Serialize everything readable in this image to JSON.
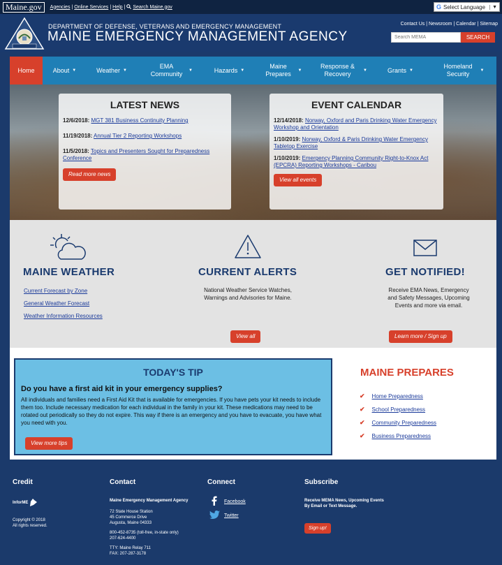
{
  "topbar": {
    "logo": "Maine.gov",
    "links": [
      "Agencies",
      "Online Services",
      "Help"
    ],
    "search_link": "Search Maine.gov",
    "language": "Select Language",
    "language_arrow": "▼"
  },
  "header": {
    "seal_top": "AGENCY",
    "seal_bottom": "STATE OF MAINE",
    "department": "DEPARTMENT OF DEFENSE, VETERANS AND EMERGENCY MANAGEMENT",
    "agency": "MAINE EMERGENCY MANAGEMENT AGENCY",
    "utility_links": [
      "Contact Us",
      "Newsroom",
      "Calendar",
      "Sitemap"
    ],
    "search_placeholder": "Search MEMA",
    "search_button": "SEARCH"
  },
  "nav": {
    "items": [
      {
        "label": "Home"
      },
      {
        "label": "About"
      },
      {
        "label": "Weather"
      },
      {
        "label": "EMA Community"
      },
      {
        "label": "Hazards"
      },
      {
        "label": "Maine Prepares"
      },
      {
        "label": "Response & Recovery"
      },
      {
        "label": "Grants"
      },
      {
        "label": "Homeland Security"
      }
    ]
  },
  "news": {
    "title": "LATEST NEWS",
    "items": [
      {
        "date": "12/6/2018:",
        "text": "MGT 381 Business Continuity Planning"
      },
      {
        "date": "11/19/2018:",
        "text": "Annual Tier 2 Reporting Workshops"
      },
      {
        "date": "11/5/2018:",
        "text": "Topics and Presenters Sought for Preparedness Conference"
      }
    ],
    "button": "Read more news"
  },
  "events": {
    "title": "EVENT CALENDAR",
    "items": [
      {
        "date": "12/14/2018:",
        "text": "Norway, Oxford and Paris Drinking Water Emergency Workshop and Orientation"
      },
      {
        "date": "1/10/2019:",
        "text": "Norway, Oxford & Paris Drinking Water Emergency Tabletop Exercise"
      },
      {
        "date": "1/10/2019:",
        "text": "Emergency Planning Community Right-to-Knox Act (EPCRA) Reporting Workshops - Caribou"
      }
    ],
    "button": "View all events"
  },
  "weather": {
    "title": "MAINE WEATHER",
    "links": [
      "Current Forecast by Zone",
      "General Weather Forecast",
      "Weather Information Resources"
    ]
  },
  "alerts": {
    "title": "CURRENT ALERTS",
    "text": "National Weather Service Watches, Warnings and Advisories for Maine.",
    "button": "View all"
  },
  "notified": {
    "title": "GET NOTIFIED!",
    "text": "Receive EMA News, Emergency and Safety Messages, Upcoming Events and more via email.",
    "button": "Learn more / Sign up"
  },
  "tip": {
    "title": "TODAY'S TIP",
    "question": "Do you have a first aid kit in your emergency supplies?",
    "body": "All individuals and families need a First Aid Kit that is available for emergencies. If you have pets your kit needs to include them too. Include necessary medication for each individual in the family in your kit. These medications may need to be rotated out periodically so they do not expire. This way if there is an emergency and you have to evacuate, you have what you need with you.",
    "button": "View more tips"
  },
  "maine_prepares": {
    "title": "MAINE PREPARES",
    "links": [
      "Home Preparedness",
      "School Preparedness",
      "Community Preparedness",
      "Business Preparedness"
    ]
  },
  "footer": {
    "credit": {
      "heading": "Credit",
      "logo": "InforME",
      "copyright": "Copyright © 2018",
      "rights": "All rights reserved."
    },
    "contact": {
      "heading": "Contact",
      "name": "Maine Emergency Management Agency",
      "address1": "72 State House Station",
      "address2": "45 Commerce Drive",
      "address3": "Augusta, Maine 04333",
      "phone": "800-452-8735 (toll-free, in-state only)",
      "phone2": "207-624-4400",
      "tty": "TTY: Maine Relay 711",
      "fax": "FAX: 207-287-3178"
    },
    "connect": {
      "heading": "Connect",
      "facebook": "Facebook",
      "twitter": "Twitter"
    },
    "subscribe": {
      "heading": "Subscribe",
      "text": "Receive MEMA News, Upcoming Events By Email or Text Message.",
      "button": "Sign up!"
    }
  },
  "colors": {
    "navy": "#1a3a6e",
    "nav_blue": "#1f7fb6",
    "accent_red": "#d7402b",
    "tip_blue": "#6cbfe4"
  }
}
